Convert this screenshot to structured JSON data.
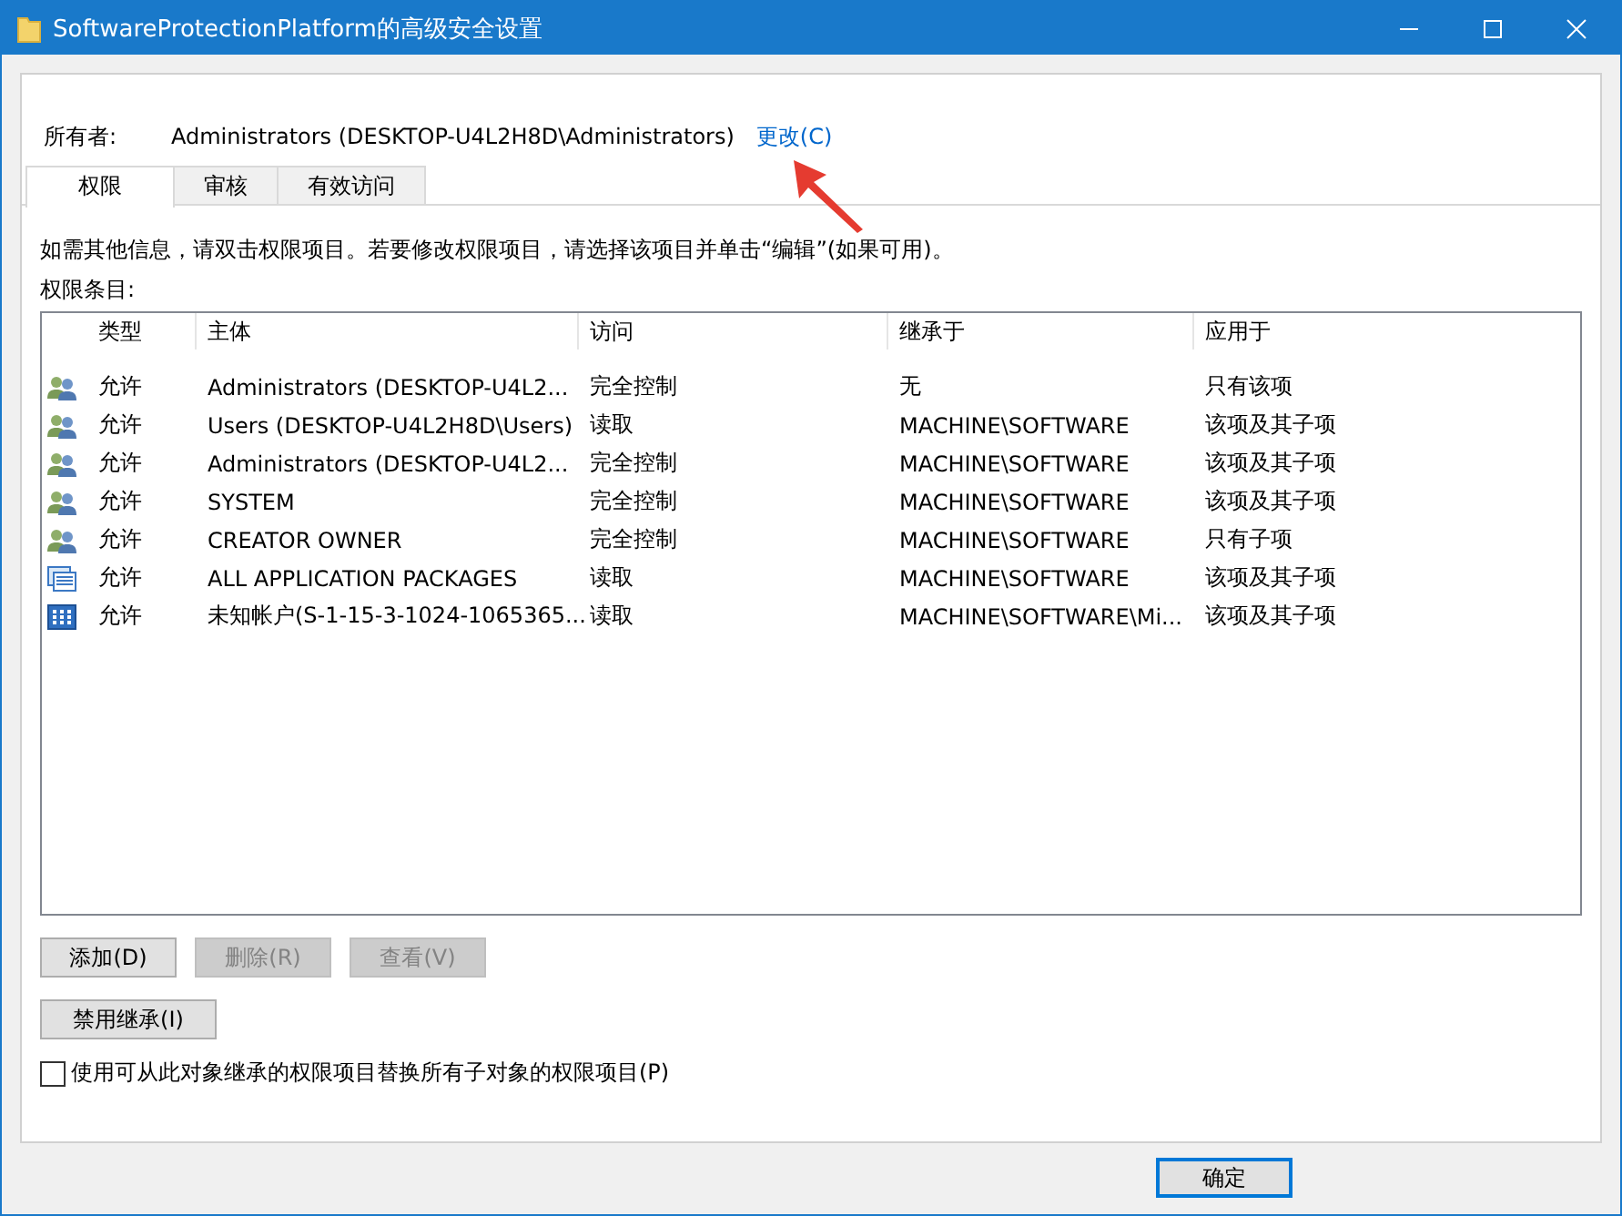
{
  "window": {
    "title": "SoftwareProtectionPlatform的高级安全设置"
  },
  "owner": {
    "label": "所有者:",
    "value": "Administrators (DESKTOP-U4L2H8D\\Administrators)",
    "link": "更改(C)"
  },
  "tabs": [
    {
      "label": "权限",
      "selected": true
    },
    {
      "label": "审核",
      "selected": false
    },
    {
      "label": "有效访问",
      "selected": false
    }
  ],
  "info_text": "如需其他信息，请双击权限项目。若要修改权限项目，请选择该项目并单击“编辑”(如果可用)。",
  "list_label": "权限条目:",
  "table": {
    "columns": [
      "类型",
      "主体",
      "访问",
      "继承于",
      "应用于"
    ],
    "rows": [
      {
        "kind": "group",
        "cells": [
          "允许",
          "Administrators (DESKTOP-U4L2...",
          "完全控制",
          "无",
          "只有该项"
        ]
      },
      {
        "kind": "group",
        "cells": [
          "允许",
          "Users (DESKTOP-U4L2H8D\\Users)",
          "读取",
          "MACHINE\\SOFTWARE",
          "该项及其子项"
        ]
      },
      {
        "kind": "group",
        "cells": [
          "允许",
          "Administrators (DESKTOP-U4L2...",
          "完全控制",
          "MACHINE\\SOFTWARE",
          "该项及其子项"
        ]
      },
      {
        "kind": "group",
        "cells": [
          "允许",
          "SYSTEM",
          "完全控制",
          "MACHINE\\SOFTWARE",
          "该项及其子项"
        ]
      },
      {
        "kind": "group",
        "cells": [
          "允许",
          "CREATOR OWNER",
          "完全控制",
          "MACHINE\\SOFTWARE",
          "只有子项"
        ]
      },
      {
        "kind": "package",
        "cells": [
          "允许",
          "ALL APPLICATION PACKAGES",
          "读取",
          "MACHINE\\SOFTWARE",
          "该项及其子项"
        ]
      },
      {
        "kind": "app",
        "cells": [
          "允许",
          "未知帐户(S-1-15-3-1024-1065365...",
          "读取",
          "MACHINE\\SOFTWARE\\Mi...",
          "该项及其子项"
        ]
      }
    ]
  },
  "actions": [
    {
      "label": "添加(D)",
      "disabled": false
    },
    {
      "label": "删除(R)",
      "disabled": true
    },
    {
      "label": "查看(V)",
      "disabled": true
    }
  ],
  "inherit_button": {
    "label": "禁用继承(I)",
    "disabled": false
  },
  "replace_checkbox": {
    "label": "使用可从此对象继承的权限项目替换所有子对象的权限项目(P)",
    "checked": false
  },
  "footer_buttons": [
    {
      "label": "确定",
      "default": true
    }
  ]
}
